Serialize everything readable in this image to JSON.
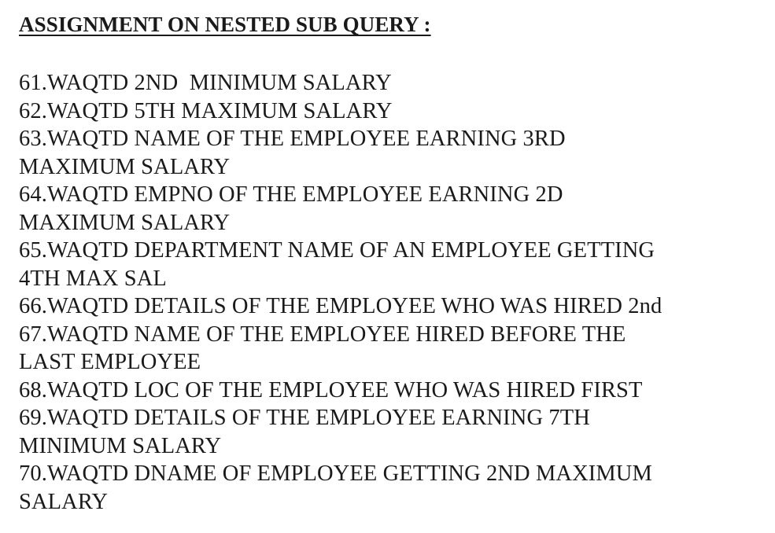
{
  "document": {
    "title": "ASSIGNMENT ON NESTED SUB QUERY :",
    "lines": [
      "61.WAQTD 2ND  MINIMUM SALARY",
      "62.WAQTD 5TH MAXIMUM SALARY",
      "63.WAQTD NAME OF THE EMPLOYEE EARNING 3RD",
      "MAXIMUM SALARY",
      "64.WAQTD EMPNO OF THE EMPLOYEE EARNING 2D",
      "MAXIMUM SALARY",
      "65.WAQTD DEPARTMENT NAME OF AN EMPLOYEE GETTING",
      "4TH MAX SAL",
      "66.WAQTD DETAILS OF THE EMPLOYEE WHO WAS HIRED 2nd",
      "67.WAQTD NAME OF THE EMPLOYEE HIRED BEFORE THE",
      "LAST EMPLOYEE",
      "68.WAQTD LOC OF THE EMPLOYEE WHO WAS HIRED FIRST",
      "69.WAQTD DETAILS OF THE EMPLOYEE EARNING 7TH",
      "MINIMUM SALARY",
      "70.WAQTD DNAME OF EMPLOYEE GETTING 2ND MAXIMUM",
      "SALARY"
    ]
  }
}
